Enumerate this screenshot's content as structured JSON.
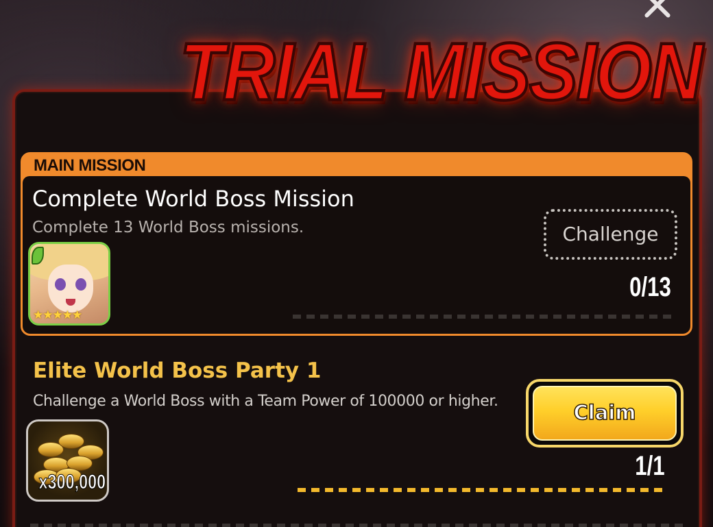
{
  "header": {
    "title": "TRIAL MISSION"
  },
  "main_mission": {
    "section_label": "MAIN MISSION",
    "title": "Complete World Boss Mission",
    "description": "Complete 13 World Boss missions.",
    "button_label": "Challenge",
    "progress_text": "0/13",
    "progress_fraction": 0.0,
    "reward_stars": "★★★★★"
  },
  "elite_mission": {
    "title": "Elite World Boss Party 1",
    "description": "Challenge a World Boss with a Team Power of 100000 or higher.",
    "reward_quantity": "x300,000",
    "reward_icon": "gold-coins-icon",
    "button_label": "Claim",
    "progress_text": "1/1",
    "progress_fraction": 1.0
  },
  "colors": {
    "accent_orange": "#f08a2c",
    "title_red": "#e2160c",
    "elite_title_gold": "#f4c24a",
    "claim_gold": "#ffcf2a"
  }
}
